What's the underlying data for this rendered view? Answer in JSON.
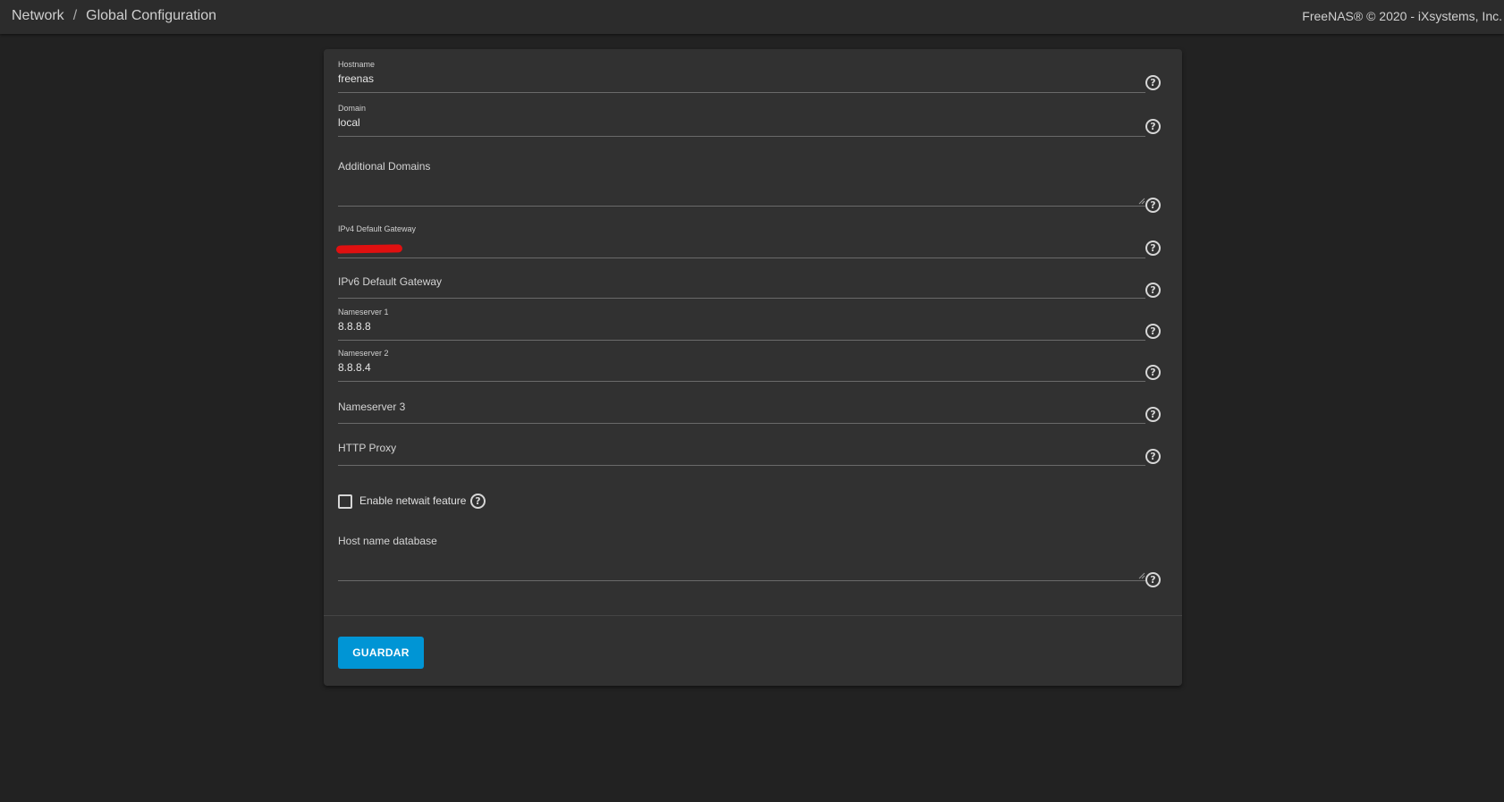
{
  "breadcrumb": {
    "items": [
      "Network",
      "Global Configuration"
    ],
    "separator": "/"
  },
  "copyright": "FreeNAS® © 2020 - iXsystems, Inc.",
  "form": {
    "hostname": {
      "label": "Hostname",
      "value": "freenas"
    },
    "domain": {
      "label": "Domain",
      "value": "local"
    },
    "additional_domains": {
      "label": "Additional Domains",
      "value": ""
    },
    "ipv4_gateway": {
      "label": "IPv4 Default Gateway",
      "value": ""
    },
    "ipv6_gateway": {
      "label": "IPv6 Default Gateway",
      "value": ""
    },
    "nameserver1": {
      "label": "Nameserver 1",
      "value": "8.8.8.8"
    },
    "nameserver2": {
      "label": "Nameserver 2",
      "value": "8.8.8.4"
    },
    "nameserver3": {
      "label": "Nameserver 3",
      "value": ""
    },
    "http_proxy": {
      "label": "HTTP Proxy",
      "value": ""
    },
    "netwait": {
      "label": "Enable netwait feature",
      "checked": false
    },
    "host_name_database": {
      "label": "Host name database",
      "value": ""
    },
    "help_glyph": "?"
  },
  "actions": {
    "save_label": "GUARDAR"
  },
  "colors": {
    "background": "#222222",
    "topbar": "#2c2c2c",
    "card": "#313131",
    "accent": "#0095d5",
    "redaction": "#e01010"
  },
  "icons": [
    "help-circle-icon",
    "resize-handle-icon"
  ]
}
